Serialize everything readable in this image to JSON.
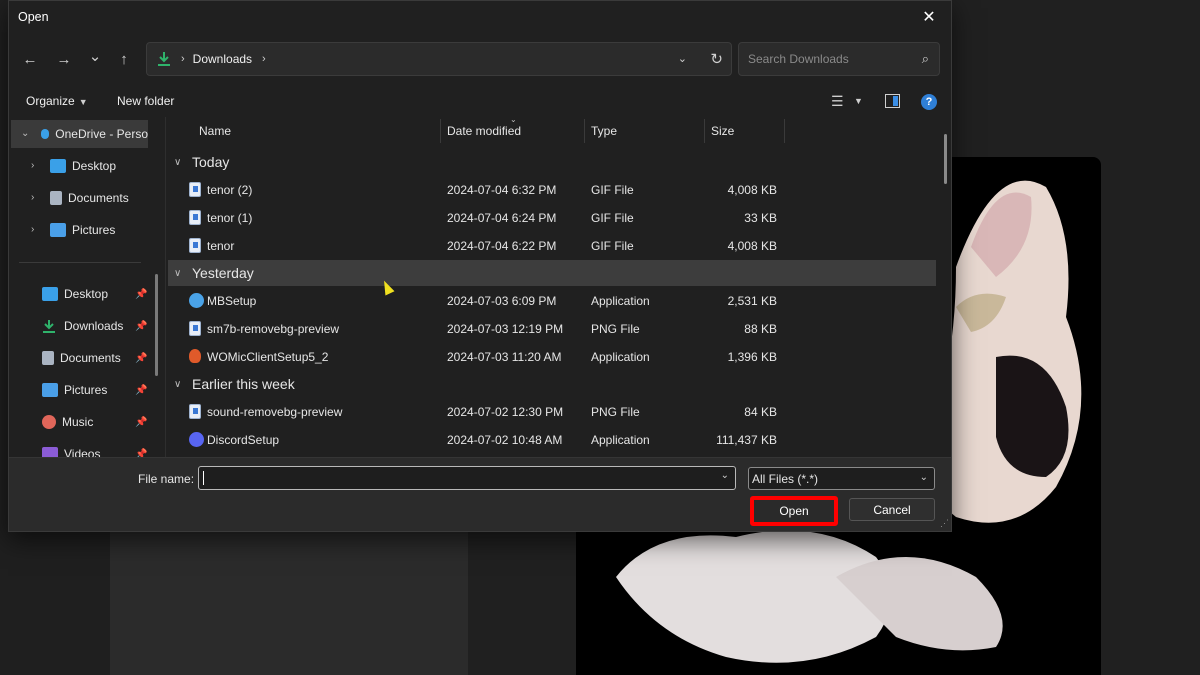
{
  "dialog": {
    "title": "Open",
    "close_glyph": "✕"
  },
  "nav": {
    "back_glyph": "←",
    "forward_glyph": "→",
    "recent_glyph": "⌄",
    "up_glyph": "↑",
    "address": "Downloads",
    "search_placeholder": "Search Downloads"
  },
  "commands": {
    "organize": "Organize",
    "new_folder": "New folder",
    "help": "?"
  },
  "sidebar": {
    "onedrive": "OneDrive - Perso",
    "tree": [
      {
        "label": "Desktop",
        "icon": "desktop-icon",
        "color": "#3aa0e8"
      },
      {
        "label": "Documents",
        "icon": "documents-icon",
        "color": "#aab4c2"
      },
      {
        "label": "Pictures",
        "icon": "pictures-icon",
        "color": "#4a9fe8"
      }
    ],
    "quick_access": [
      {
        "label": "Desktop",
        "icon": "desktop-icon",
        "color": "#3aa0e8"
      },
      {
        "label": "Downloads",
        "icon": "downloads-icon",
        "color": "#2fb36b"
      },
      {
        "label": "Documents",
        "icon": "documents-icon",
        "color": "#aab4c2"
      },
      {
        "label": "Pictures",
        "icon": "pictures-icon",
        "color": "#4a9fe8"
      },
      {
        "label": "Music",
        "icon": "music-icon",
        "color": "#e0665a"
      },
      {
        "label": "Videos",
        "icon": "videos-icon",
        "color": "#8b5cd6"
      }
    ]
  },
  "columns": {
    "name": "Name",
    "date": "Date modified",
    "type": "Type",
    "size": "Size"
  },
  "groups": [
    {
      "label": "Today",
      "files": [
        {
          "name": "tenor (2)",
          "date": "2024-07-04 6:32 PM",
          "type": "GIF File",
          "size": "4,008 KB",
          "icon": "gif-file-icon"
        },
        {
          "name": "tenor (1)",
          "date": "2024-07-04 6:24 PM",
          "type": "GIF File",
          "size": "33 KB",
          "icon": "gif-file-icon"
        },
        {
          "name": "tenor",
          "date": "2024-07-04 6:22 PM",
          "type": "GIF File",
          "size": "4,008 KB",
          "icon": "gif-file-icon"
        }
      ]
    },
    {
      "label": "Yesterday",
      "files": [
        {
          "name": "MBSetup",
          "date": "2024-07-03 6:09 PM",
          "type": "Application",
          "size": "2,531 KB",
          "icon": "mbsetup-app-icon"
        },
        {
          "name": "sm7b-removebg-preview",
          "date": "2024-07-03 12:19 PM",
          "type": "PNG File",
          "size": "88 KB",
          "icon": "png-file-icon"
        },
        {
          "name": "WOMicClientSetup5_2",
          "date": "2024-07-03 11:20 AM",
          "type": "Application",
          "size": "1,396 KB",
          "icon": "womic-app-icon"
        }
      ]
    },
    {
      "label": "Earlier this week",
      "files": [
        {
          "name": "sound-removebg-preview",
          "date": "2024-07-02 12:30 PM",
          "type": "PNG File",
          "size": "84 KB",
          "icon": "png-file-icon"
        },
        {
          "name": "DiscordSetup",
          "date": "2024-07-02 10:48 AM",
          "type": "Application",
          "size": "111,437 KB",
          "icon": "discord-app-icon"
        }
      ]
    }
  ],
  "footer": {
    "file_name_label": "File name:",
    "file_name_value": "",
    "filter": "All Files (*.*)",
    "open": "Open",
    "cancel": "Cancel"
  }
}
